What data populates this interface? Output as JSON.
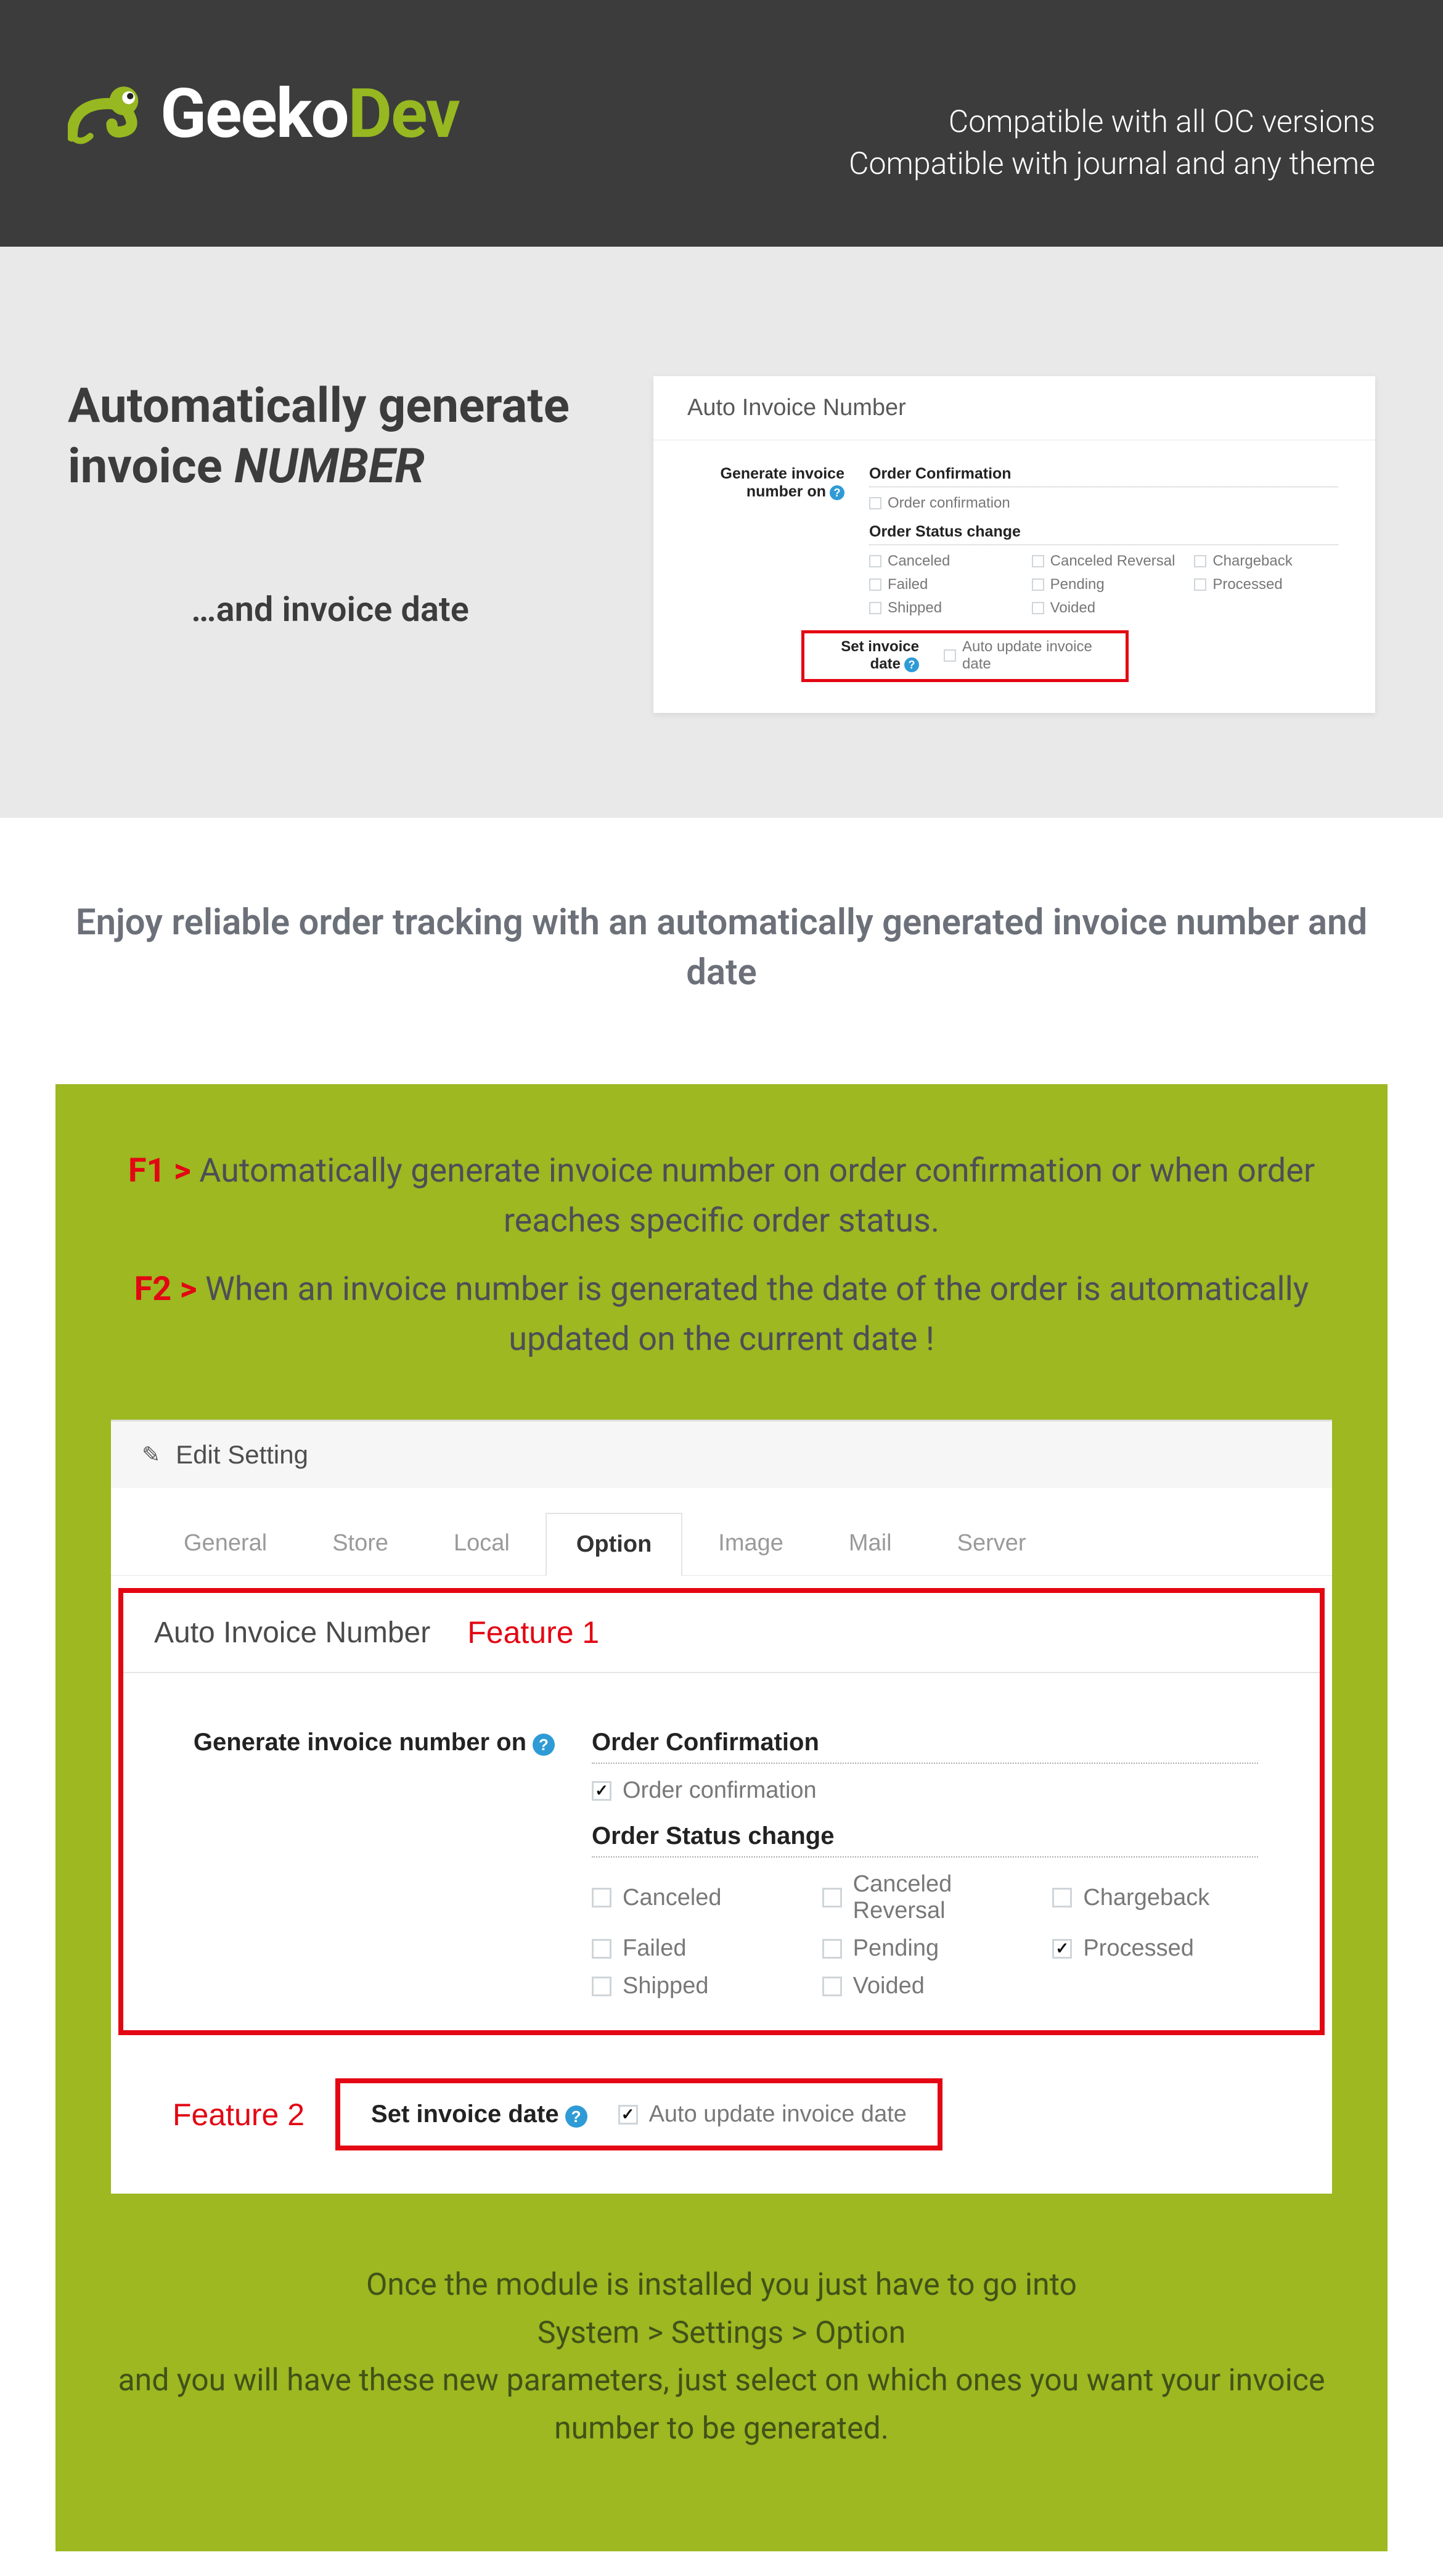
{
  "header": {
    "logo_part1": "Geeko",
    "logo_part2": "Dev",
    "line1": "Compatible with all OC versions",
    "line2": "Compatible with journal and any theme"
  },
  "hero": {
    "title_pre": "Automatically generate invoice ",
    "title_em": "NUMBER",
    "sub": "…and invoice date"
  },
  "panel_small": {
    "title": "Auto Invoice Number",
    "label_generate": "Generate invoice number on",
    "sec_confirmation": "Order Confirmation",
    "opt_confirmation": "Order confirmation",
    "sec_status": "Order Status change",
    "statuses": [
      "Canceled",
      "Canceled Reversal",
      "Chargeback",
      "Failed",
      "Pending",
      "Processed",
      "Shipped",
      "Voided"
    ],
    "label_setdate": "Set invoice date",
    "opt_setdate": "Auto update invoice date"
  },
  "intro": "Enjoy reliable order tracking with an automatically generated invoice number and date",
  "features": {
    "f1_key": "F1 > ",
    "f1_text": "Automatically generate invoice number on order confirmation or when order reaches specific order status.",
    "f2_key": "F2 > ",
    "f2_text": "When an invoice number is generated the date of the order is automatically updated on the current date !"
  },
  "big_panel": {
    "edit_setting": "Edit Setting",
    "tabs": [
      "General",
      "Store",
      "Local",
      "Option",
      "Image",
      "Mail",
      "Server"
    ],
    "active_tab_index": 3,
    "f1_section_title": "Auto Invoice Number",
    "f1_tag": "Feature 1",
    "label_generate": "Generate invoice number on",
    "sec_confirmation": "Order Confirmation",
    "opt_confirmation": "Order confirmation",
    "opt_confirmation_checked": true,
    "sec_status": "Order Status change",
    "statuses": [
      {
        "label": "Canceled",
        "checked": false
      },
      {
        "label": "Canceled Reversal",
        "checked": false
      },
      {
        "label": "Chargeback",
        "checked": false
      },
      {
        "label": "Failed",
        "checked": false
      },
      {
        "label": "Pending",
        "checked": false
      },
      {
        "label": "Processed",
        "checked": true
      },
      {
        "label": "Shipped",
        "checked": false
      },
      {
        "label": "Voided",
        "checked": false
      }
    ],
    "f2_tag": "Feature 2",
    "label_setdate": "Set invoice date",
    "opt_setdate": "Auto update invoice date",
    "opt_setdate_checked": true
  },
  "instructions": {
    "l1": "Once the module is installed you just have to go into",
    "l2": "System > Settings > Option",
    "l3": "and you will have these new parameters, just select on which ones you want your invoice number to be generated."
  }
}
